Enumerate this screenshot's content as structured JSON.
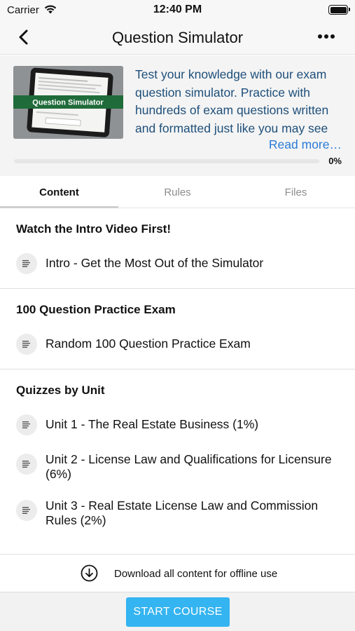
{
  "status_bar": {
    "carrier": "Carrier",
    "time": "12:40 PM"
  },
  "nav": {
    "title": "Question Simulator",
    "back_icon": "chevron-left-icon",
    "more_icon": "ellipsis-icon"
  },
  "course": {
    "thumbnail_caption": "Question Simulator",
    "description": "Test your knowledge with our exam question simulator. Practice with hundreds of exam questions written and formatted just like you may see",
    "read_more": "Read more…",
    "progress_value": 0,
    "progress_label": "0%"
  },
  "tabs": [
    {
      "label": "Content",
      "active": true
    },
    {
      "label": "Rules",
      "active": false
    },
    {
      "label": "Files",
      "active": false
    }
  ],
  "sections": [
    {
      "title": "Watch the Intro Video First!",
      "lessons": [
        "Intro - Get the Most Out of the Simulator"
      ]
    },
    {
      "title": "100 Question Practice Exam",
      "lessons": [
        "Random 100 Question Practice Exam"
      ]
    },
    {
      "title": "Quizzes by Unit",
      "lessons": [
        "Unit 1 - The Real Estate Business (1%)",
        "Unit 2 - License Law and Qualifications for Licensure (6%)",
        "Unit 3 - Real Estate License Law and Commission Rules (2%)"
      ]
    }
  ],
  "download": {
    "label": "Download all content for offline use",
    "icon": "download-circle-icon"
  },
  "footer": {
    "start_button": "START COURSE"
  },
  "colors": {
    "accent": "#34b4f0",
    "link": "#2a7bd6",
    "description": "#1e4f7a"
  }
}
